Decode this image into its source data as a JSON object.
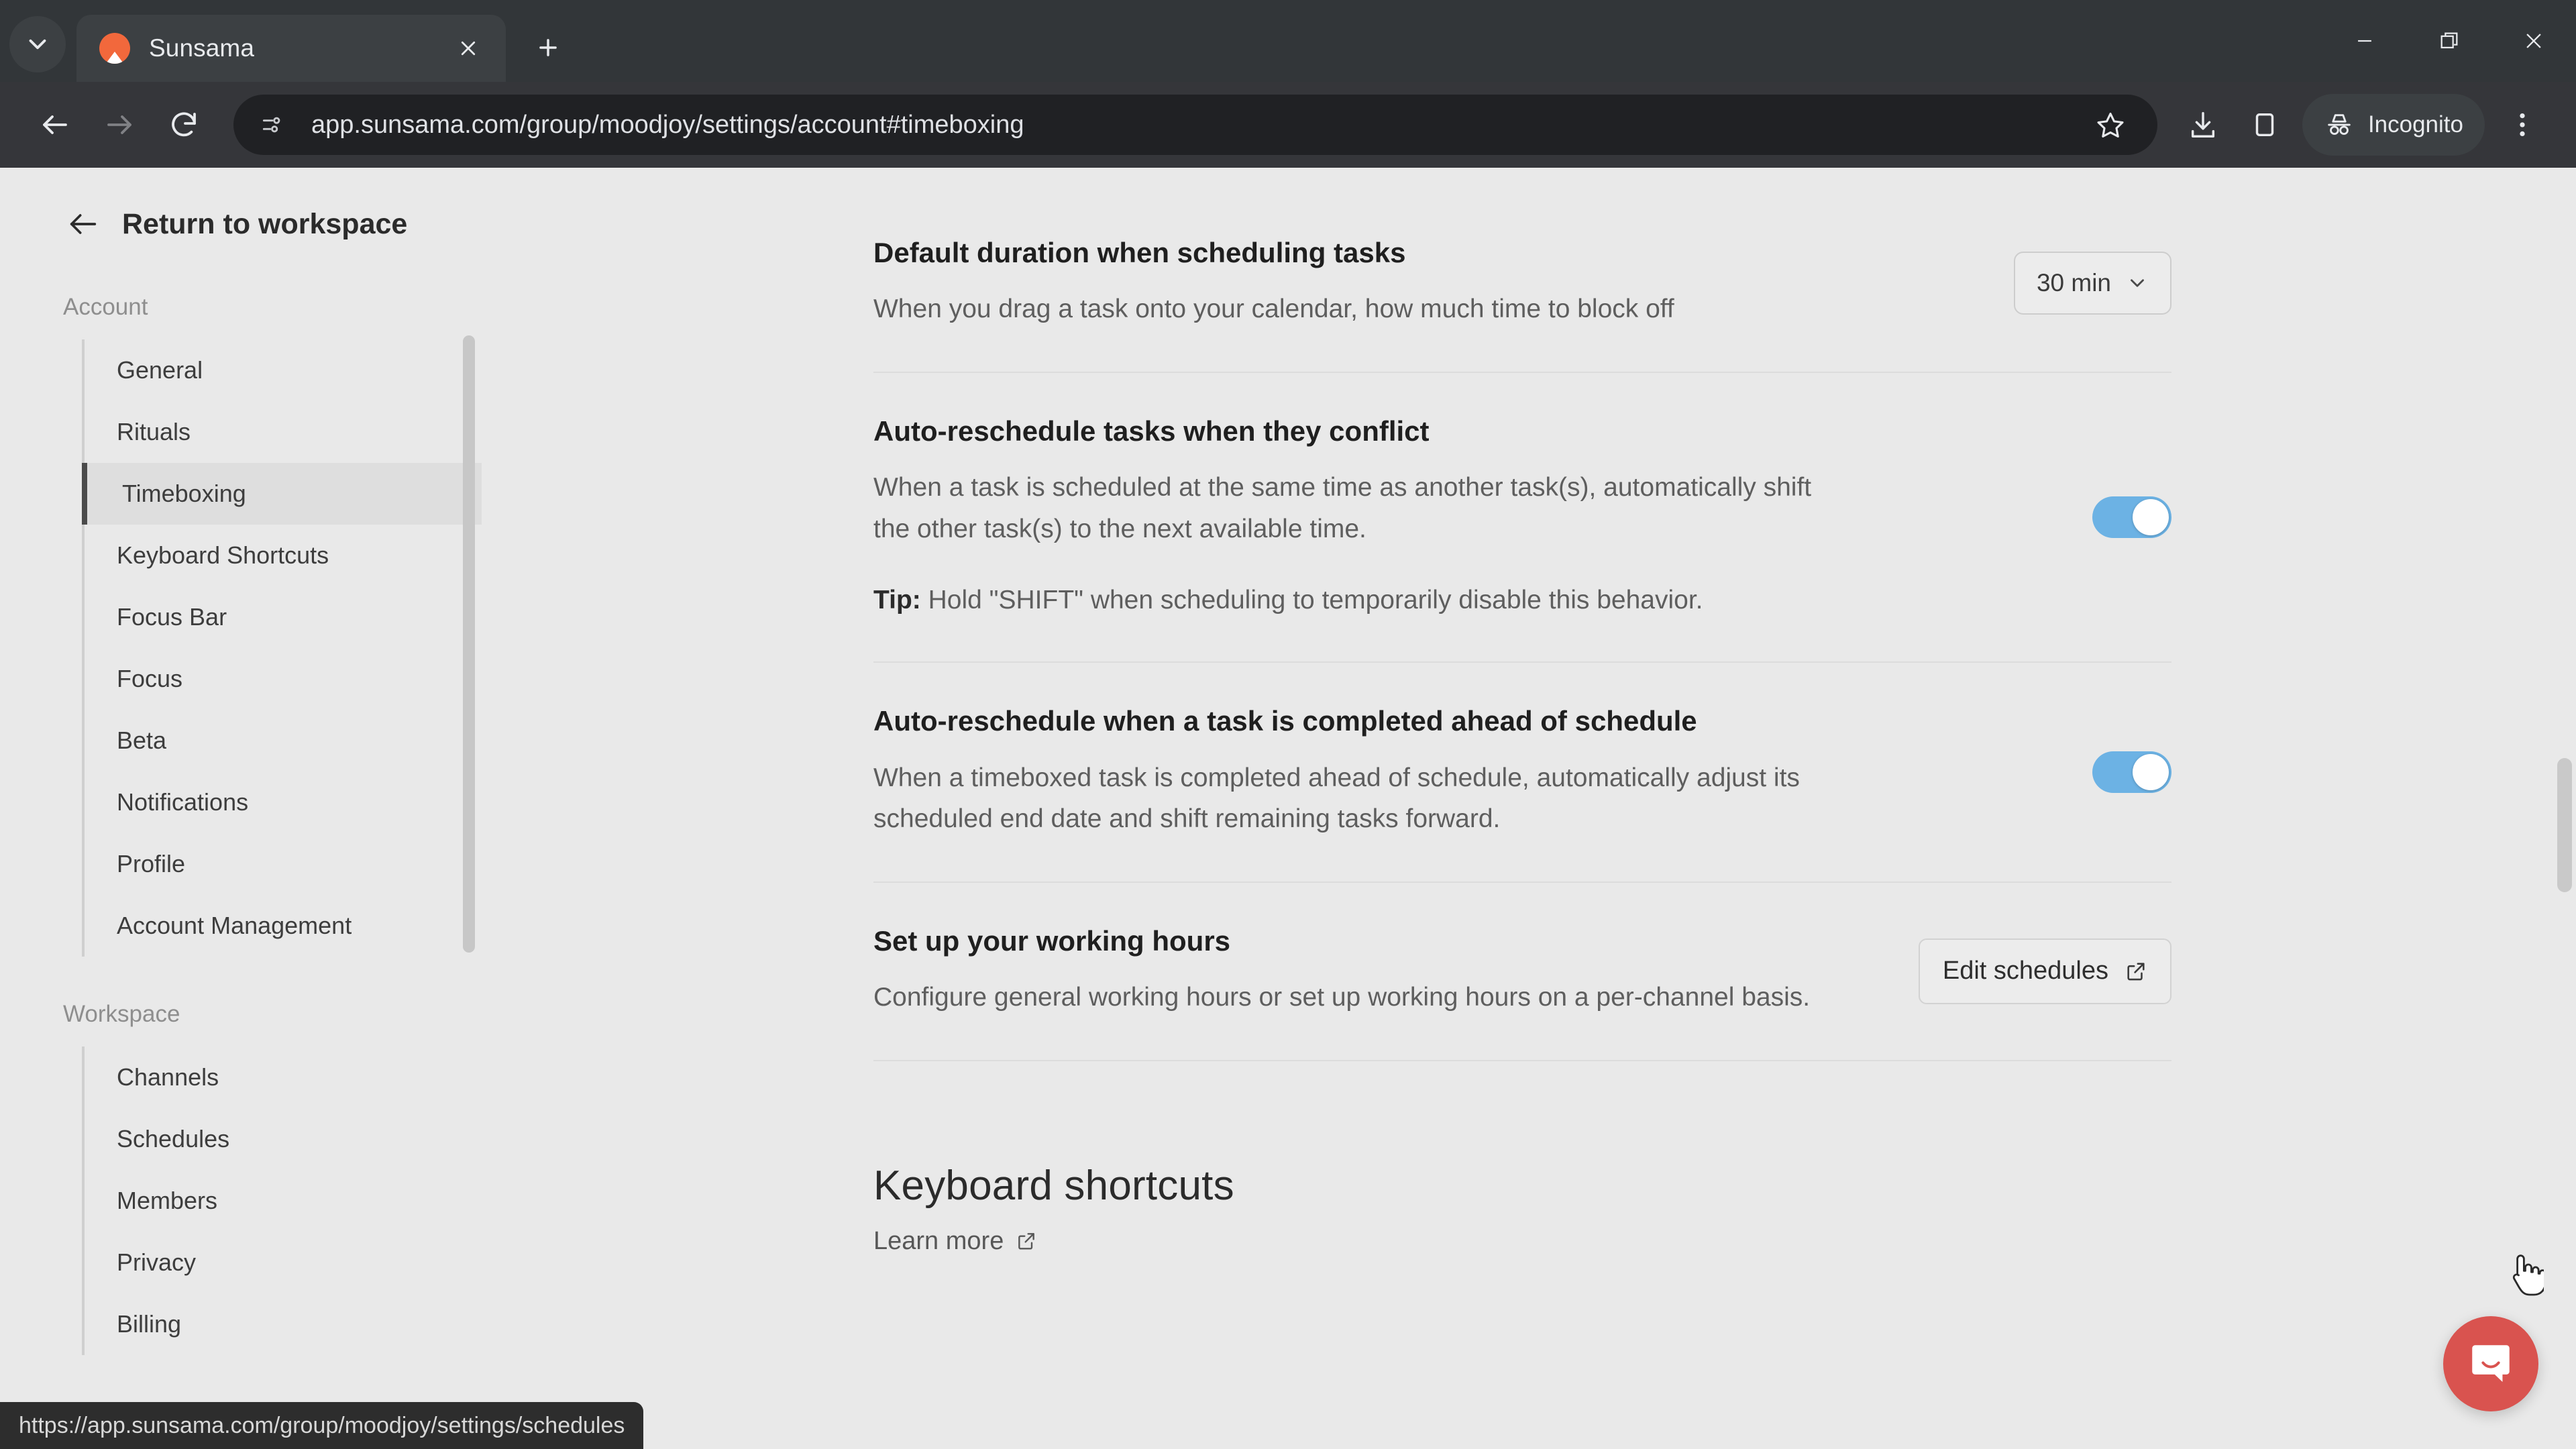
{
  "browser": {
    "tab": {
      "title": "Sunsama",
      "favicon_name": "sunsama-favicon",
      "close_label": "×"
    },
    "tab_search_name": "tab-search-icon",
    "new_tab_name": "new-tab-icon",
    "window_controls": {
      "minimize": "minimize-icon",
      "restore": "restore-icon",
      "close": "close-window-icon"
    },
    "toolbar": {
      "back": "back-arrow-icon",
      "forward": "forward-arrow-icon",
      "reload": "reload-icon",
      "site_info": "site-settings-icon",
      "url": "app.sunsama.com/group/moodjoy/settings/account#timeboxing",
      "bookmark": "bookmark-star-icon",
      "download": "download-icon",
      "side_panel": "side-panel-icon",
      "incognito_label": "Incognito",
      "menu": "three-dot-menu-icon"
    }
  },
  "statusbar": {
    "url": "https://app.sunsama.com/group/moodjoy/settings/schedules"
  },
  "sidebar": {
    "return_label": "Return to workspace",
    "groups": [
      {
        "title": "Account",
        "items": [
          {
            "label": "General",
            "active": false
          },
          {
            "label": "Rituals",
            "active": false
          },
          {
            "label": "Timeboxing",
            "active": true
          },
          {
            "label": "Keyboard Shortcuts",
            "active": false
          },
          {
            "label": "Focus Bar",
            "active": false
          },
          {
            "label": "Focus",
            "active": false
          },
          {
            "label": "Beta",
            "active": false
          },
          {
            "label": "Notifications",
            "active": false
          },
          {
            "label": "Profile",
            "active": false
          },
          {
            "label": "Account Management",
            "active": false
          }
        ]
      },
      {
        "title": "Workspace",
        "items": [
          {
            "label": "Channels",
            "active": false
          },
          {
            "label": "Schedules",
            "active": false
          },
          {
            "label": "Members",
            "active": false
          },
          {
            "label": "Privacy",
            "active": false
          },
          {
            "label": "Billing",
            "active": false
          }
        ]
      }
    ]
  },
  "main": {
    "settings": [
      {
        "title": "Default duration when scheduling tasks",
        "desc": "When you drag a task onto your calendar, how much time to block off",
        "control": "select",
        "value": "30 min"
      },
      {
        "title": "Auto-reschedule tasks when they conflict",
        "desc": "When a task is scheduled at the same time as another task(s), automatically shift the other task(s) to the next available time.",
        "tip_label": "Tip:",
        "tip_text": " Hold \"SHIFT\" when scheduling to temporarily disable this behavior.",
        "control": "toggle",
        "value": "on"
      },
      {
        "title": "Auto-reschedule when a task is completed ahead of schedule",
        "desc": "When a timeboxed task is completed ahead of schedule, automatically adjust its scheduled end date and shift remaining tasks forward.",
        "control": "toggle",
        "value": "on"
      },
      {
        "title": "Set up your working hours",
        "desc": "Configure general working hours or set up working hours on a per-channel basis.",
        "control": "button",
        "value": "Edit schedules"
      }
    ],
    "keyboard_section": {
      "heading": "Keyboard shortcuts",
      "learn_more": "Learn more"
    }
  },
  "intercom": {
    "name": "intercom-messenger-launcher"
  },
  "colors": {
    "toggle_on": "#6cb2e4",
    "intercom": "#d9534f",
    "page_bg": "#e9e9e9",
    "accent_favicon": "#f2683c"
  }
}
